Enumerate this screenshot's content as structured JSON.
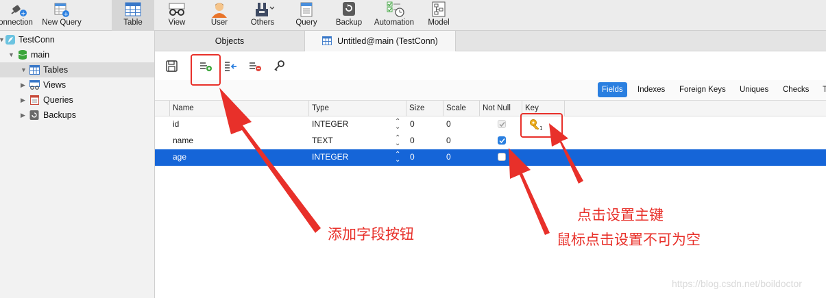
{
  "toolbar": {
    "items": [
      {
        "label": "onnection",
        "icon": "connection-plug-icon"
      },
      {
        "label": "New Query",
        "icon": "new-query-icon"
      },
      {
        "label": "Table",
        "icon": "table-grid-icon",
        "active": true
      },
      {
        "label": "View",
        "icon": "glasses-icon"
      },
      {
        "label": "User",
        "icon": "user-avatar-icon"
      },
      {
        "label": "Others",
        "icon": "tools-icon"
      },
      {
        "label": "Query",
        "icon": "query-icon"
      },
      {
        "label": "Backup",
        "icon": "backup-icon"
      },
      {
        "label": "Automation",
        "icon": "automation-icon"
      },
      {
        "label": "Model",
        "icon": "model-icon"
      }
    ]
  },
  "sidebar": {
    "connection": "TestConn",
    "database": "main",
    "items": [
      {
        "label": "Tables",
        "icon": "table-icon"
      },
      {
        "label": "Views",
        "icon": "view-icon"
      },
      {
        "label": "Queries",
        "icon": "query-icon"
      },
      {
        "label": "Backups",
        "icon": "backup-icon"
      }
    ]
  },
  "tabs": {
    "objects": "Objects",
    "editor": "Untitled@main (TestConn)"
  },
  "subtabs": [
    "Fields",
    "Indexes",
    "Foreign Keys",
    "Uniques",
    "Checks",
    "T"
  ],
  "grid": {
    "columns": [
      "Name",
      "Type",
      "Size",
      "Scale",
      "Not Null",
      "Key"
    ],
    "rows": [
      {
        "name": "id",
        "type": "INTEGER",
        "size": "0",
        "scale": "0",
        "not_null": true,
        "not_null_disabled": true,
        "key": true
      },
      {
        "name": "name",
        "type": "TEXT",
        "size": "0",
        "scale": "0",
        "not_null": true,
        "key": false
      },
      {
        "name": "age",
        "type": "INTEGER",
        "size": "0",
        "scale": "0",
        "not_null": false,
        "key": false
      }
    ],
    "selected_row": 2
  },
  "annotations": {
    "add_field": "添加字段按钮",
    "set_primary_key": "点击设置主键",
    "set_not_null": "鼠标点击设置不可为空"
  },
  "watermark": "https://blog.csdn.net/boildoctor",
  "colors": {
    "annotation": "#e8302a",
    "selection": "#1565d8",
    "accent": "#2a7fe0"
  }
}
